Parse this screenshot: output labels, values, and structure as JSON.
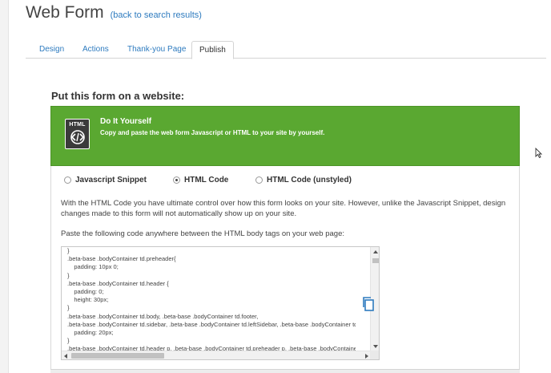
{
  "page": {
    "title": "Web Form",
    "back_link": "(back to search results)"
  },
  "tabs": [
    {
      "label": "Design",
      "active": false
    },
    {
      "label": "Actions",
      "active": false
    },
    {
      "label": "Thank-you Page",
      "active": false
    },
    {
      "label": "Publish",
      "active": true
    }
  ],
  "section": {
    "title": "Put this form on a website:"
  },
  "banner": {
    "icon_label": "HTML",
    "icon": "html-code-icon",
    "heading": "Do It Yourself",
    "subtitle": "Copy and paste the web form Javascript or HTML to your site by yourself.",
    "color": "#5aa831"
  },
  "embed_options": [
    {
      "label": "Javascript Snippet",
      "selected": false
    },
    {
      "label": "HTML Code",
      "selected": true
    },
    {
      "label": "HTML Code (unstyled)",
      "selected": false
    }
  ],
  "description": "With the HTML Code you have ultimate control over how this form looks on your site. However, unlike the Javascript Snippet, design changes made to this form will not automatically show up on your site.",
  "paste_instruction": "Paste the following code anywhere between the HTML body tags on your web page:",
  "code_lines": [
    "}",
    ".beta-base .bodyContainer td.preheader{",
    "    padding: 10px 0;",
    "}",
    ".beta-base .bodyContainer td.header {",
    "    padding: 0;",
    "    height: 30px;",
    "}",
    ".beta-base .bodyContainer td.body, .beta-base .bodyContainer td.footer,",
    ".beta-base .bodyContainer td.sidebar, .beta-base .bodyContainer td.leftSidebar, .beta-base .bodyContainer td.rightSidebar {",
    "    padding: 20px;",
    "}",
    ".beta-base .bodyContainer td.header p, .beta-base .bodyContainer td.preheader p, .beta-base .bodyContainer td.body p {"
  ],
  "copy_button": {
    "icon": "copy-icon",
    "color": "#2e7bbf"
  }
}
